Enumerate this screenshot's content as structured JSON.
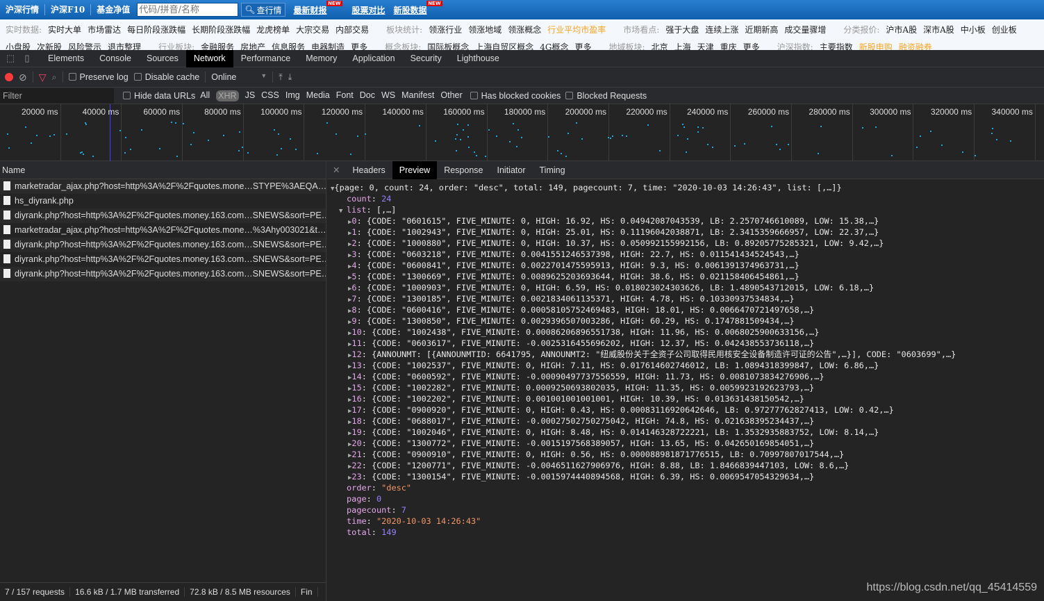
{
  "topbar": {
    "nav": [
      "沪深行情",
      "沪深F10",
      "基金净值"
    ],
    "search_placeholder": "代码/拼音/名称",
    "query_button": "查行情",
    "links": [
      {
        "label": "最新财报",
        "badge": "NEW"
      },
      {
        "label": "股票对比",
        "badge": ""
      },
      {
        "label": "新股数据",
        "badge": "NEW"
      }
    ]
  },
  "subnav": {
    "row1": [
      {
        "t": "实时数据:",
        "c": "lab"
      },
      {
        "t": "实时大单"
      },
      {
        "t": "市场雷达"
      },
      {
        "t": "每日阶段涨跌幅"
      },
      {
        "t": "长期阶段涨跌幅"
      },
      {
        "t": "龙虎榜单"
      },
      {
        "t": "大宗交易"
      },
      {
        "t": "内部交易"
      },
      {
        "t": "板块统计:",
        "c": "lab"
      },
      {
        "t": "领涨行业"
      },
      {
        "t": "领涨地域"
      },
      {
        "t": "领涨概念"
      },
      {
        "t": "行业平均市盈率",
        "c": "hl"
      },
      {
        "t": "市场看点:",
        "c": "lab"
      },
      {
        "t": "强于大盘"
      },
      {
        "t": "连续上涨"
      },
      {
        "t": "近期新高"
      },
      {
        "t": "成交量骤增"
      },
      {
        "t": "分类报价:",
        "c": "lab"
      },
      {
        "t": "沪市A股"
      },
      {
        "t": "深市A股"
      },
      {
        "t": "中小板"
      },
      {
        "t": "创业板"
      }
    ],
    "row2": [
      {
        "t": "小盘股"
      },
      {
        "t": "次新股"
      },
      {
        "t": "风险警示"
      },
      {
        "t": "退市整理"
      },
      {
        "t": "行业板块:",
        "c": "lab"
      },
      {
        "t": "金融服务"
      },
      {
        "t": "房地产"
      },
      {
        "t": "信息服务"
      },
      {
        "t": "电器制造"
      },
      {
        "t": "更多"
      },
      {
        "t": "概念板块:",
        "c": "lab"
      },
      {
        "t": "国际板概念"
      },
      {
        "t": "上海自贸区概念"
      },
      {
        "t": "4G概念"
      },
      {
        "t": "更多"
      },
      {
        "t": "地域板块:",
        "c": "lab"
      },
      {
        "t": "北京"
      },
      {
        "t": "上海"
      },
      {
        "t": "天津"
      },
      {
        "t": "重庆"
      },
      {
        "t": "更多"
      },
      {
        "t": "沪深指数:",
        "c": "lab"
      },
      {
        "t": "主要指数"
      },
      {
        "t": "新股申购",
        "c": "hl"
      },
      {
        "t": "融资融券",
        "c": "hl"
      }
    ]
  },
  "devtools": {
    "tabs": [
      "Elements",
      "Console",
      "Sources",
      "Network",
      "Performance",
      "Memory",
      "Application",
      "Security",
      "Lighthouse"
    ],
    "active_tab": "Network",
    "toolbar": {
      "preserve_log": "Preserve log",
      "disable_cache": "Disable cache",
      "throttle": "Online"
    },
    "filter": {
      "placeholder": "Filter",
      "hide_data_urls": "Hide data URLs",
      "types": [
        "All",
        "XHR",
        "JS",
        "CSS",
        "Img",
        "Media",
        "Font",
        "Doc",
        "WS",
        "Manifest",
        "Other"
      ],
      "active_type": "XHR",
      "has_blocked": "Has blocked cookies",
      "blocked_requests": "Blocked Requests"
    },
    "timeline": [
      "20000 ms",
      "40000 ms",
      "60000 ms",
      "80000 ms",
      "100000 ms",
      "120000 ms",
      "140000 ms",
      "160000 ms",
      "180000 ms",
      "200000 ms",
      "220000 ms",
      "240000 ms",
      "260000 ms",
      "280000 ms",
      "300000 ms",
      "320000 ms",
      "340000 ms"
    ],
    "name_header": "Name",
    "requests": [
      "marketradar_ajax.php?host=http%3A%2F%2Fquotes.mone…STYPE%3AEQA…",
      "hs_diyrank.php",
      "diyrank.php?host=http%3A%2F%2Fquotes.money.163.com…SNEWS&sort=PE…",
      "marketradar_ajax.php?host=http%3A%2F%2Fquotes.mone…%3Ahy003021&t…",
      "diyrank.php?host=http%3A%2F%2Fquotes.money.163.com…SNEWS&sort=PE…",
      "diyrank.php?host=http%3A%2F%2Fquotes.money.163.com…SNEWS&sort=PE…",
      "diyrank.php?host=http%3A%2F%2Fquotes.money.163.com…SNEWS&sort=PE…"
    ],
    "detail_tabs": [
      "Headers",
      "Preview",
      "Response",
      "Initiator",
      "Timing"
    ],
    "active_detail": "Preview",
    "status": [
      "7 / 157 requests",
      "16.6 kB / 1.7 MB transferred",
      "72.8 kB / 8.5 MB resources",
      "Fin"
    ]
  },
  "preview": {
    "summary": "{page: 0, count: 24, order: \"desc\", total: 149, pagecount: 7, time: \"2020-10-03 14:26:43\", list: [,…]}",
    "count": "24",
    "list_summary": "[,…]",
    "list": [
      "{CODE: \"0601615\", FIVE_MINUTE: 0, HIGH: 16.92, HS: 0.04942087043539, LB: 2.2570746610089, LOW: 15.38,…}",
      "{CODE: \"1002943\", FIVE_MINUTE: 0, HIGH: 25.01, HS: 0.11196042038871, LB: 2.3415359666957, LOW: 22.37,…}",
      "{CODE: \"1000880\", FIVE_MINUTE: 0, HIGH: 10.37, HS: 0.050992155992156, LB: 0.89205775285321, LOW: 9.42,…}",
      "{CODE: \"0603218\", FIVE_MINUTE: 0.0041551246537398, HIGH: 22.7, HS: 0.011541434524543,…}",
      "{CODE: \"0600841\", FIVE_MINUTE: 0.0022701475595913, HIGH: 9.3, HS: 0.0061391374963731,…}",
      "{CODE: \"1300669\", FIVE_MINUTE: 0.0089625203693644, HIGH: 38.6, HS: 0.021158406454861,…}",
      "{CODE: \"1000903\", FIVE_MINUTE: 0, HIGH: 6.59, HS: 0.018023024303626, LB: 1.4890543712015, LOW: 6.18,…}",
      "{CODE: \"1300185\", FIVE_MINUTE: 0.0021834061135371, HIGH: 4.78, HS: 0.10330937534834,…}",
      "{CODE: \"0600416\", FIVE_MINUTE: 0.00058105752469483, HIGH: 18.01, HS: 0.0066470721497658,…}",
      "{CODE: \"1300850\", FIVE_MINUTE: 0.0029396507003286, HIGH: 60.29, HS: 0.1747881509434,…}",
      "{CODE: \"1002438\", FIVE_MINUTE: 0.00086206896551738, HIGH: 11.96, HS: 0.0068025900633156,…}",
      "{CODE: \"0603617\", FIVE_MINUTE: -0.0025316455696202, HIGH: 12.37, HS: 0.042438553736118,…}",
      "{ANNOUNMT: [{ANNOUNMTID: 6641795, ANNOUNMT2: \"纽威股份关于全资子公司取得民用核安全设备制造许可证的公告\",…}], CODE: \"0603699\",…}",
      "{CODE: \"1002537\", FIVE_MINUTE: 0, HIGH: 7.11, HS: 0.017614602746012, LB: 1.0894318399847, LOW: 6.86,…}",
      "{CODE: \"0600592\", FIVE_MINUTE: -0.00090497737556559, HIGH: 11.73, HS: 0.0081073834276906,…}",
      "{CODE: \"1002282\", FIVE_MINUTE: 0.0009250693802035, HIGH: 11.35, HS: 0.0059923192623793,…}",
      "{CODE: \"1002202\", FIVE_MINUTE: 0.001001001001001, HIGH: 10.39, HS: 0.013631438150542,…}",
      "{CODE: \"0900920\", FIVE_MINUTE: 0, HIGH: 0.43, HS: 0.00083116920642646, LB: 0.97277762827413, LOW: 0.42,…}",
      "{CODE: \"0688017\", FIVE_MINUTE: -0.00027502750275042, HIGH: 74.8, HS: 0.021638395234437,…}",
      "{CODE: \"1002046\", FIVE_MINUTE: 0, HIGH: 8.48, HS: 0.014146328722221, LB: 1.3532935883752, LOW: 8.14,…}",
      "{CODE: \"1300772\", FIVE_MINUTE: -0.0015197568389057, HIGH: 13.65, HS: 0.042650169854051,…}",
      "{CODE: \"0900910\", FIVE_MINUTE: 0, HIGH: 0.56, HS: 0.000088981871776515, LB: 0.70997807017544,…}",
      "{CODE: \"1200771\", FIVE_MINUTE: -0.0046511627906976, HIGH: 8.88, LB: 1.8466839447103, LOW: 8.6,…}",
      "{CODE: \"1300154\", FIVE_MINUTE: -0.0015974440894568, HIGH: 6.39, HS: 0.0069547054329634,…}"
    ],
    "order": "\"desc\"",
    "page": "0",
    "pagecount": "7",
    "time": "\"2020-10-03 14:26:43\"",
    "total": "149"
  },
  "watermark": "https://blog.csdn.net/qq_45414559",
  "colors": {
    "record": "#ff3b3b",
    "filter_icon": "#ff3e6c",
    "number": "#9980ff",
    "string": "#f29766",
    "key": "#e3a8e8",
    "highlight": "#f5a623"
  }
}
